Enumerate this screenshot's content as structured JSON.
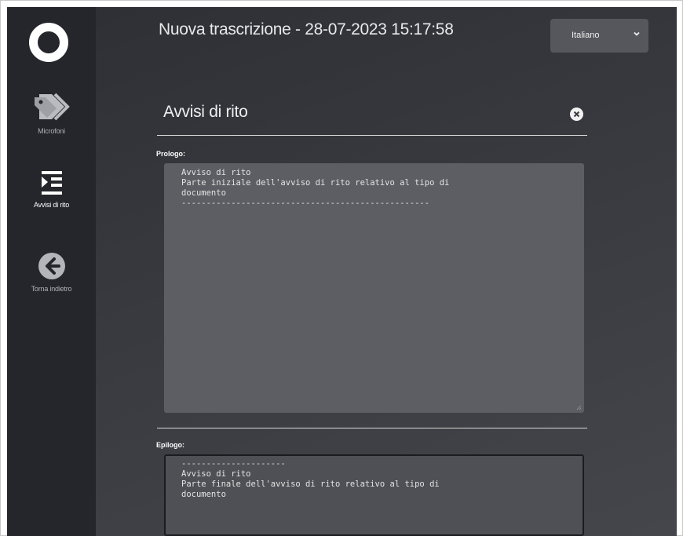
{
  "window": {
    "title": "Nuova trascrizione - 28-07-2023 15:17:58"
  },
  "language": {
    "selected": "Italiano"
  },
  "sidebar": {
    "items": [
      {
        "label": "Microfoni",
        "icon": "tag-icon"
      },
      {
        "label": "Avvisi di rito",
        "icon": "list-indent-icon"
      },
      {
        "label": "Torna indietro",
        "icon": "arrow-left-circle-icon"
      }
    ]
  },
  "panel": {
    "title": "Avvisi di rito",
    "prologo": {
      "label": "Prologo:",
      "value": "Avviso di rito\nParte iniziale dell'avviso di rito relativo al tipo di\ndocumento\n--------------------------------------------------"
    },
    "epilogo": {
      "label": "Epilogo:",
      "value": "---------------------\nAvviso di rito\nParte finale dell'avviso di rito relativo al tipo di\ndocumento"
    }
  }
}
